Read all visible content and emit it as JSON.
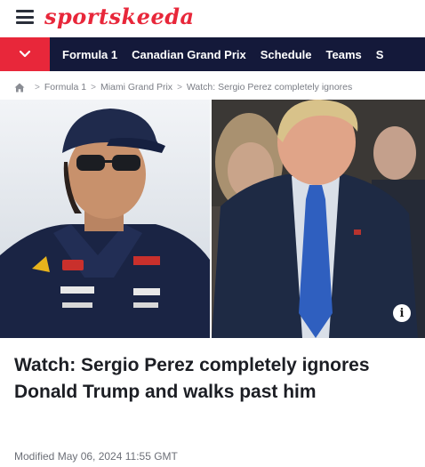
{
  "header": {
    "logo_text": "sportskeeda",
    "menu_icon": "hamburger-menu-icon",
    "brand_color": "#e8273a"
  },
  "nav": {
    "toggle_icon": "chevron-down-icon",
    "background": "#14193a",
    "items": [
      "Formula 1",
      "Canadian Grand Prix",
      "Schedule",
      "Teams",
      "S"
    ]
  },
  "breadcrumb": {
    "home_icon": "home-icon",
    "items": [
      "Formula 1",
      "Miami Grand Prix",
      "Watch: Sergio Perez completely ignores"
    ],
    "separator": ">"
  },
  "hero": {
    "info_label": "i"
  },
  "article": {
    "headline": "Watch: Sergio Perez completely ignores Donald Trump and walks past him",
    "modified": "Modified May 06, 2024 11:55 GMT"
  }
}
